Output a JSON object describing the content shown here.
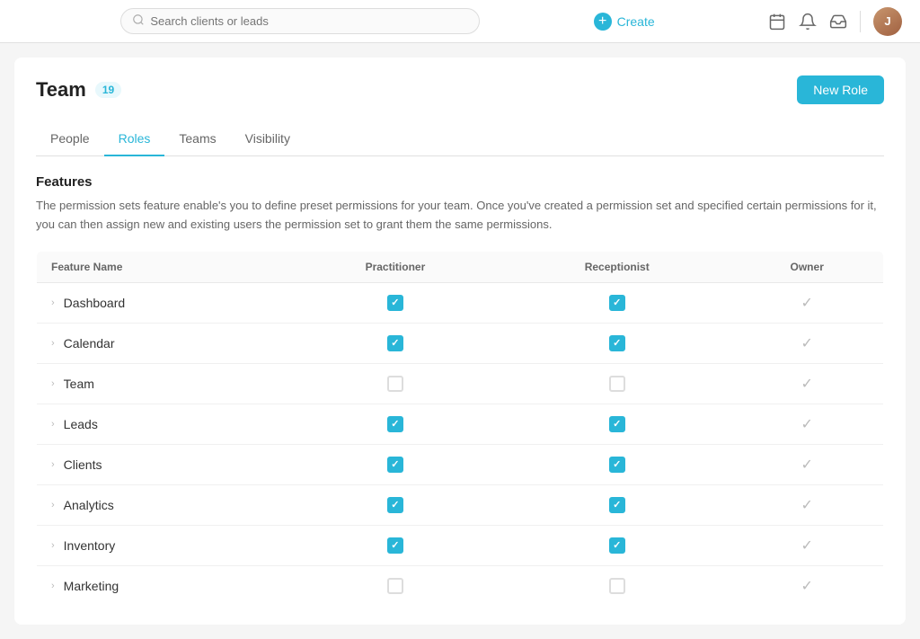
{
  "topnav": {
    "search_placeholder": "Search clients or leads",
    "create_label": "Create"
  },
  "page": {
    "title": "Team",
    "badge": "19",
    "new_role_label": "New Role"
  },
  "tabs": [
    {
      "id": "people",
      "label": "People",
      "active": false
    },
    {
      "id": "roles",
      "label": "Roles",
      "active": true
    },
    {
      "id": "teams",
      "label": "Teams",
      "active": false
    },
    {
      "id": "visibility",
      "label": "Visibility",
      "active": false
    }
  ],
  "features_section": {
    "title": "Features",
    "description": "The permission sets feature enable's you to define preset permissions for your team. Once you've created a permission set and specified certain permissions for it, you can then assign new and existing users the permission set to grant them the same permissions."
  },
  "table": {
    "columns": [
      {
        "id": "feature_name",
        "label": "Feature Name"
      },
      {
        "id": "practitioner",
        "label": "Practitioner"
      },
      {
        "id": "receptionist",
        "label": "Receptionist"
      },
      {
        "id": "owner",
        "label": "Owner"
      }
    ],
    "rows": [
      {
        "name": "Dashboard",
        "practitioner": "checked",
        "receptionist": "checked",
        "owner": "check"
      },
      {
        "name": "Calendar",
        "practitioner": "checked",
        "receptionist": "checked",
        "owner": "check"
      },
      {
        "name": "Team",
        "practitioner": "empty",
        "receptionist": "empty",
        "owner": "check"
      },
      {
        "name": "Leads",
        "practitioner": "checked",
        "receptionist": "checked",
        "owner": "check"
      },
      {
        "name": "Clients",
        "practitioner": "checked",
        "receptionist": "checked",
        "owner": "check"
      },
      {
        "name": "Analytics",
        "practitioner": "checked",
        "receptionist": "checked",
        "owner": "check"
      },
      {
        "name": "Inventory",
        "practitioner": "checked",
        "receptionist": "checked",
        "owner": "check"
      },
      {
        "name": "Marketing",
        "practitioner": "empty",
        "receptionist": "empty",
        "owner": "check"
      }
    ]
  }
}
